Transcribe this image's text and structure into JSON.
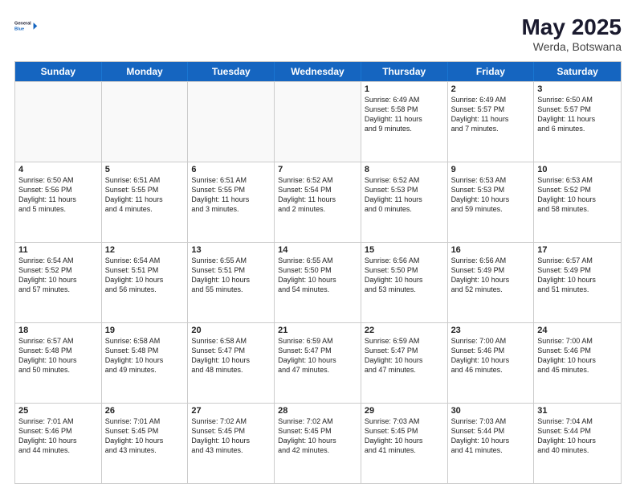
{
  "header": {
    "logo_general": "General",
    "logo_blue": "Blue",
    "month_year": "May 2025",
    "location": "Werda, Botswana"
  },
  "days_of_week": [
    "Sunday",
    "Monday",
    "Tuesday",
    "Wednesday",
    "Thursday",
    "Friday",
    "Saturday"
  ],
  "weeks": [
    [
      {
        "day": "",
        "text": "",
        "empty": true
      },
      {
        "day": "",
        "text": "",
        "empty": true
      },
      {
        "day": "",
        "text": "",
        "empty": true
      },
      {
        "day": "",
        "text": "",
        "empty": true
      },
      {
        "day": "1",
        "text": "Sunrise: 6:49 AM\nSunset: 5:58 PM\nDaylight: 11 hours\nand 9 minutes.",
        "empty": false
      },
      {
        "day": "2",
        "text": "Sunrise: 6:49 AM\nSunset: 5:57 PM\nDaylight: 11 hours\nand 7 minutes.",
        "empty": false
      },
      {
        "day": "3",
        "text": "Sunrise: 6:50 AM\nSunset: 5:57 PM\nDaylight: 11 hours\nand 6 minutes.",
        "empty": false
      }
    ],
    [
      {
        "day": "4",
        "text": "Sunrise: 6:50 AM\nSunset: 5:56 PM\nDaylight: 11 hours\nand 5 minutes.",
        "empty": false
      },
      {
        "day": "5",
        "text": "Sunrise: 6:51 AM\nSunset: 5:55 PM\nDaylight: 11 hours\nand 4 minutes.",
        "empty": false
      },
      {
        "day": "6",
        "text": "Sunrise: 6:51 AM\nSunset: 5:55 PM\nDaylight: 11 hours\nand 3 minutes.",
        "empty": false
      },
      {
        "day": "7",
        "text": "Sunrise: 6:52 AM\nSunset: 5:54 PM\nDaylight: 11 hours\nand 2 minutes.",
        "empty": false
      },
      {
        "day": "8",
        "text": "Sunrise: 6:52 AM\nSunset: 5:53 PM\nDaylight: 11 hours\nand 0 minutes.",
        "empty": false
      },
      {
        "day": "9",
        "text": "Sunrise: 6:53 AM\nSunset: 5:53 PM\nDaylight: 10 hours\nand 59 minutes.",
        "empty": false
      },
      {
        "day": "10",
        "text": "Sunrise: 6:53 AM\nSunset: 5:52 PM\nDaylight: 10 hours\nand 58 minutes.",
        "empty": false
      }
    ],
    [
      {
        "day": "11",
        "text": "Sunrise: 6:54 AM\nSunset: 5:52 PM\nDaylight: 10 hours\nand 57 minutes.",
        "empty": false
      },
      {
        "day": "12",
        "text": "Sunrise: 6:54 AM\nSunset: 5:51 PM\nDaylight: 10 hours\nand 56 minutes.",
        "empty": false
      },
      {
        "day": "13",
        "text": "Sunrise: 6:55 AM\nSunset: 5:51 PM\nDaylight: 10 hours\nand 55 minutes.",
        "empty": false
      },
      {
        "day": "14",
        "text": "Sunrise: 6:55 AM\nSunset: 5:50 PM\nDaylight: 10 hours\nand 54 minutes.",
        "empty": false
      },
      {
        "day": "15",
        "text": "Sunrise: 6:56 AM\nSunset: 5:50 PM\nDaylight: 10 hours\nand 53 minutes.",
        "empty": false
      },
      {
        "day": "16",
        "text": "Sunrise: 6:56 AM\nSunset: 5:49 PM\nDaylight: 10 hours\nand 52 minutes.",
        "empty": false
      },
      {
        "day": "17",
        "text": "Sunrise: 6:57 AM\nSunset: 5:49 PM\nDaylight: 10 hours\nand 51 minutes.",
        "empty": false
      }
    ],
    [
      {
        "day": "18",
        "text": "Sunrise: 6:57 AM\nSunset: 5:48 PM\nDaylight: 10 hours\nand 50 minutes.",
        "empty": false
      },
      {
        "day": "19",
        "text": "Sunrise: 6:58 AM\nSunset: 5:48 PM\nDaylight: 10 hours\nand 49 minutes.",
        "empty": false
      },
      {
        "day": "20",
        "text": "Sunrise: 6:58 AM\nSunset: 5:47 PM\nDaylight: 10 hours\nand 48 minutes.",
        "empty": false
      },
      {
        "day": "21",
        "text": "Sunrise: 6:59 AM\nSunset: 5:47 PM\nDaylight: 10 hours\nand 47 minutes.",
        "empty": false
      },
      {
        "day": "22",
        "text": "Sunrise: 6:59 AM\nSunset: 5:47 PM\nDaylight: 10 hours\nand 47 minutes.",
        "empty": false
      },
      {
        "day": "23",
        "text": "Sunrise: 7:00 AM\nSunset: 5:46 PM\nDaylight: 10 hours\nand 46 minutes.",
        "empty": false
      },
      {
        "day": "24",
        "text": "Sunrise: 7:00 AM\nSunset: 5:46 PM\nDaylight: 10 hours\nand 45 minutes.",
        "empty": false
      }
    ],
    [
      {
        "day": "25",
        "text": "Sunrise: 7:01 AM\nSunset: 5:46 PM\nDaylight: 10 hours\nand 44 minutes.",
        "empty": false
      },
      {
        "day": "26",
        "text": "Sunrise: 7:01 AM\nSunset: 5:45 PM\nDaylight: 10 hours\nand 43 minutes.",
        "empty": false
      },
      {
        "day": "27",
        "text": "Sunrise: 7:02 AM\nSunset: 5:45 PM\nDaylight: 10 hours\nand 43 minutes.",
        "empty": false
      },
      {
        "day": "28",
        "text": "Sunrise: 7:02 AM\nSunset: 5:45 PM\nDaylight: 10 hours\nand 42 minutes.",
        "empty": false
      },
      {
        "day": "29",
        "text": "Sunrise: 7:03 AM\nSunset: 5:45 PM\nDaylight: 10 hours\nand 41 minutes.",
        "empty": false
      },
      {
        "day": "30",
        "text": "Sunrise: 7:03 AM\nSunset: 5:44 PM\nDaylight: 10 hours\nand 41 minutes.",
        "empty": false
      },
      {
        "day": "31",
        "text": "Sunrise: 7:04 AM\nSunset: 5:44 PM\nDaylight: 10 hours\nand 40 minutes.",
        "empty": false
      }
    ]
  ]
}
